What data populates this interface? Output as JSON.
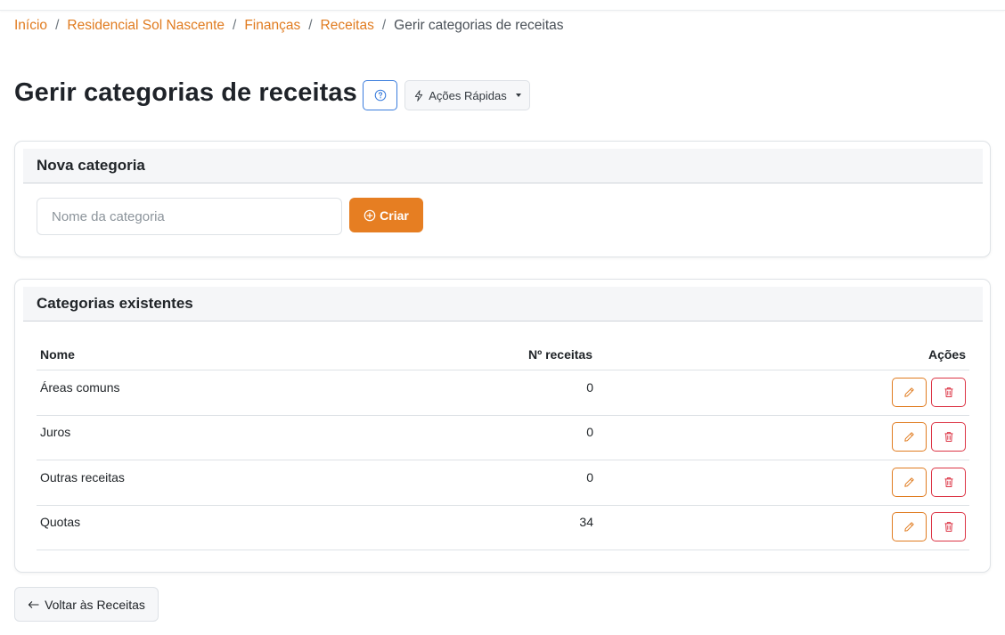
{
  "breadcrumb": {
    "items": [
      "Início",
      "Residencial Sol Nascente",
      "Finanças",
      "Receitas"
    ],
    "separator": "/",
    "current": "Gerir categorias de receitas"
  },
  "header": {
    "title": "Gerir categorias de receitas",
    "help_icon": "question-circle-icon",
    "quick_actions_label": "Ações Rápidas"
  },
  "new_category": {
    "title": "Nova categoria",
    "input_placeholder": "Nome da categoria",
    "input_value": "",
    "create_label": "Criar"
  },
  "existing": {
    "title": "Categorias existentes",
    "columns": {
      "name": "Nome",
      "count": "Nº receitas",
      "actions": "Ações"
    },
    "rows": [
      {
        "name": "Áreas comuns",
        "count": "0"
      },
      {
        "name": "Juros",
        "count": "0"
      },
      {
        "name": "Outras receitas",
        "count": "0"
      },
      {
        "name": "Quotas",
        "count": "34"
      }
    ]
  },
  "footer": {
    "back_label": "Voltar às Receitas"
  },
  "colors": {
    "accent": "#e67e22",
    "link": "#e07b1f",
    "danger": "#dc3545",
    "help": "#3b7ddd"
  }
}
